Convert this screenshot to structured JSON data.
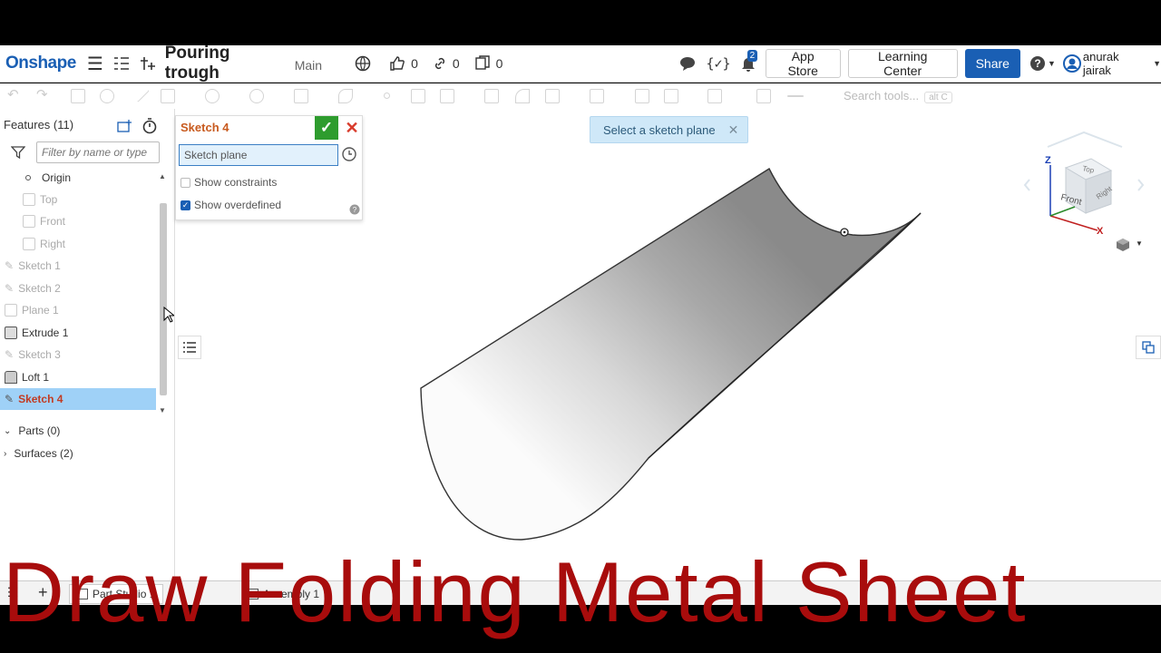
{
  "header": {
    "logo": "Onshape",
    "document_title": "Pouring trough",
    "branch": "Main",
    "likes_count": "0",
    "links_count": "0",
    "copies_count": "0",
    "notifications_count": "2",
    "app_store_label": "App Store",
    "learning_center_label": "Learning Center",
    "share_label": "Share",
    "user_name": "anurak jairak"
  },
  "toolbar": {
    "search_placeholder": "Search tools...",
    "search_shortcut": "alt C"
  },
  "features_panel": {
    "title": "Features (11)",
    "filter_placeholder": "Filter by name or type",
    "items": [
      {
        "label": "Origin",
        "state": "normal"
      },
      {
        "label": "Top",
        "state": "dim"
      },
      {
        "label": "Front",
        "state": "dim"
      },
      {
        "label": "Right",
        "state": "dim"
      },
      {
        "label": "Sketch 1",
        "state": "dim"
      },
      {
        "label": "Sketch 2",
        "state": "dim"
      },
      {
        "label": "Plane 1",
        "state": "dim"
      },
      {
        "label": "Extrude 1",
        "state": "normal"
      },
      {
        "label": "Sketch 3",
        "state": "dim"
      },
      {
        "label": "Loft 1",
        "state": "normal"
      },
      {
        "label": "Sketch 4",
        "state": "selected"
      }
    ],
    "parts_label": "Parts (0)",
    "surfaces_label": "Surfaces (2)"
  },
  "sketch_dialog": {
    "title": "Sketch 4",
    "plane_field": "Sketch plane",
    "show_constraints_label": "Show constraints",
    "show_constraints_checked": false,
    "show_overdefined_label": "Show overdefined",
    "show_overdefined_checked": true
  },
  "toast": {
    "message": "Select a sketch plane"
  },
  "view_cube": {
    "top": "Top",
    "front": "Front",
    "right": "Right",
    "axis_x": "X",
    "axis_z": "Z"
  },
  "bottom_tabs": {
    "part_studio": "Part Studio 1",
    "assembly": "Assembly 1"
  },
  "overlay_caption": "Draw  Folding Metal Sheet",
  "colors": {
    "brand_blue": "#1a5fb4",
    "sketch_title_orange": "#c85a1e",
    "selected_row": "#9fd1f7",
    "caption_red": "#a80c0c"
  }
}
